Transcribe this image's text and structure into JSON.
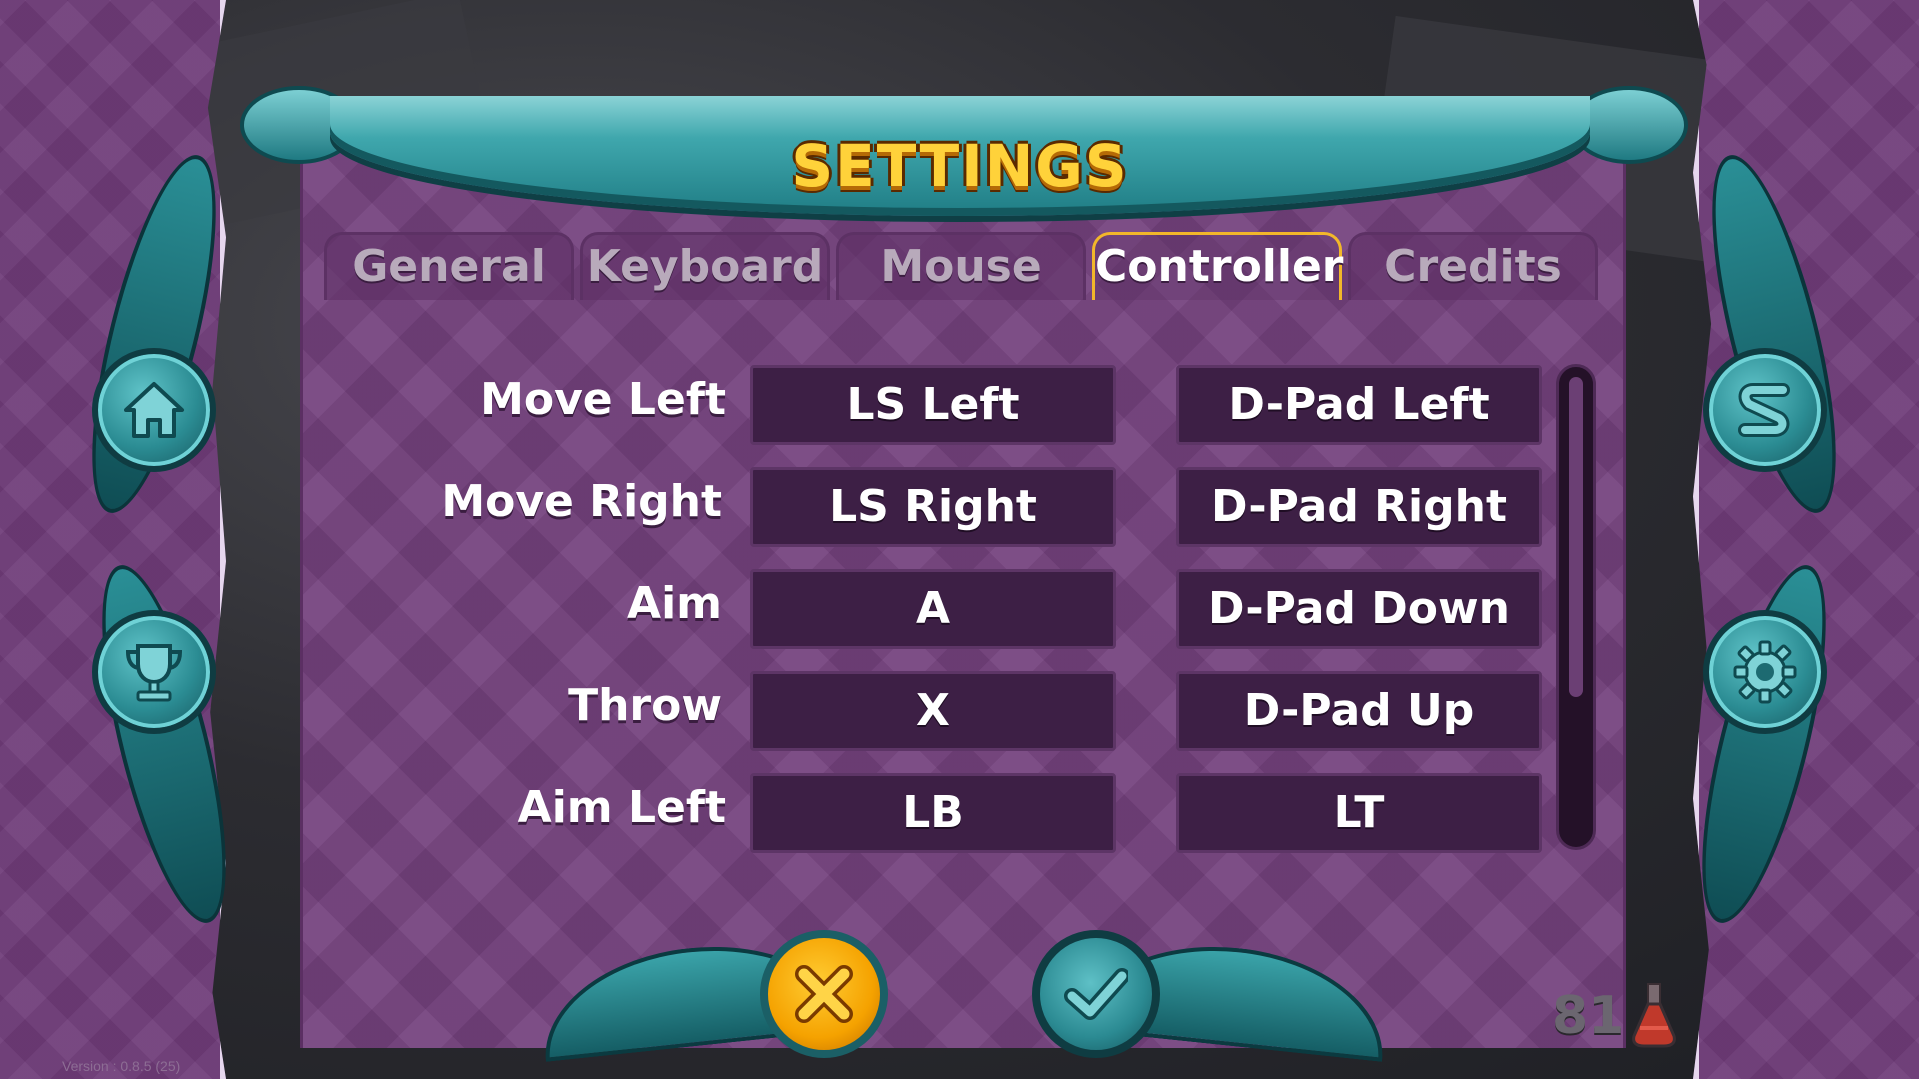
{
  "title": "SETTINGS",
  "tabs": [
    {
      "label": "General",
      "active": false
    },
    {
      "label": "Keyboard",
      "active": false
    },
    {
      "label": "Mouse",
      "active": false
    },
    {
      "label": "Controller",
      "active": true
    },
    {
      "label": "Credits",
      "active": false
    }
  ],
  "bindings": [
    {
      "action": "Move Left",
      "primary": "LS Left",
      "secondary": "D-Pad Left"
    },
    {
      "action": "Move Right",
      "primary": "LS Right",
      "secondary": "D-Pad Right"
    },
    {
      "action": "Aim",
      "primary": "A",
      "secondary": "D-Pad Down"
    },
    {
      "action": "Throw",
      "primary": "X",
      "secondary": "D-Pad Up"
    },
    {
      "action": "Aim Left",
      "primary": "LB",
      "secondary": "LT"
    }
  ],
  "side_buttons": {
    "left": [
      "home-icon",
      "trophy-icon"
    ],
    "right": [
      "s-logo-icon",
      "gear-icon"
    ]
  },
  "bottom_buttons": {
    "cancel": "close-icon",
    "confirm": "check-icon"
  },
  "potion_count": "81",
  "version": "Version : 0.8.5 (25)",
  "colors": {
    "accent": "#ffd23a",
    "panel": "#73407c",
    "teal": "#2b8c93",
    "active_tab_border": "#f2b72a"
  }
}
